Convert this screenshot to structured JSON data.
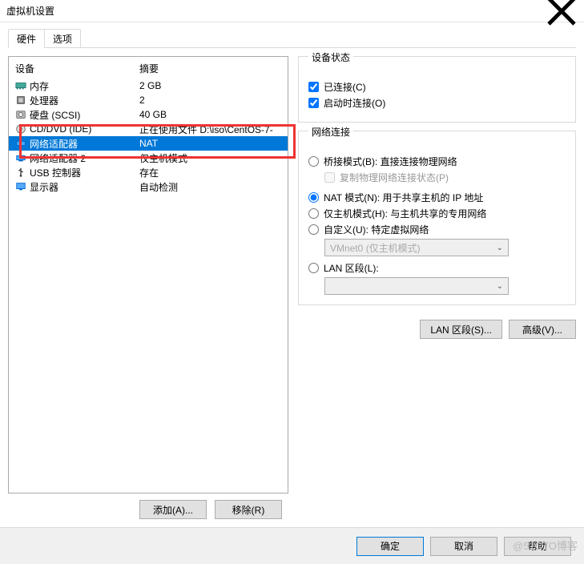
{
  "window": {
    "title": "虚拟机设置"
  },
  "tabs": {
    "hardware": "硬件",
    "options": "选项"
  },
  "list": {
    "col_device": "设备",
    "col_summary": "摘要",
    "rows": [
      {
        "device": "内存",
        "summary": "2 GB",
        "icon": "memory"
      },
      {
        "device": "处理器",
        "summary": "2",
        "icon": "cpu"
      },
      {
        "device": "硬盘 (SCSI)",
        "summary": "40 GB",
        "icon": "disk"
      },
      {
        "device": "CD/DVD (IDE)",
        "summary": "正在使用文件 D:\\iso\\CentOS-7-",
        "icon": "cd"
      },
      {
        "device": "网络适配器",
        "summary": "NAT",
        "icon": "net"
      },
      {
        "device": "网络适配器 2",
        "summary": "仅主机模式",
        "icon": "net"
      },
      {
        "device": "USB 控制器",
        "summary": "存在",
        "icon": "usb"
      },
      {
        "device": "显示器",
        "summary": "自动检测",
        "icon": "display"
      }
    ]
  },
  "left_buttons": {
    "add": "添加(A)...",
    "remove": "移除(R)"
  },
  "device_status": {
    "legend": "设备状态",
    "connected": "已连接(C)",
    "connect_at_poweron": "启动时连接(O)"
  },
  "network": {
    "legend": "网络连接",
    "bridged": "桥接模式(B): 直接连接物理网络",
    "replicate": "复制物理网络连接状态(P)",
    "nat": "NAT 模式(N): 用于共享主机的 IP 地址",
    "hostonly": "仅主机模式(H): 与主机共享的专用网络",
    "custom": "自定义(U): 特定虚拟网络",
    "custom_value": "VMnet0 (仅主机模式)",
    "lan_segment": "LAN 区段(L):",
    "lan_value": ""
  },
  "right_buttons": {
    "lan_segments": "LAN 区段(S)...",
    "advanced": "高级(V)..."
  },
  "footer": {
    "ok": "确定",
    "cancel": "取消",
    "help": "帮助"
  },
  "watermark": "@51CTO博客"
}
